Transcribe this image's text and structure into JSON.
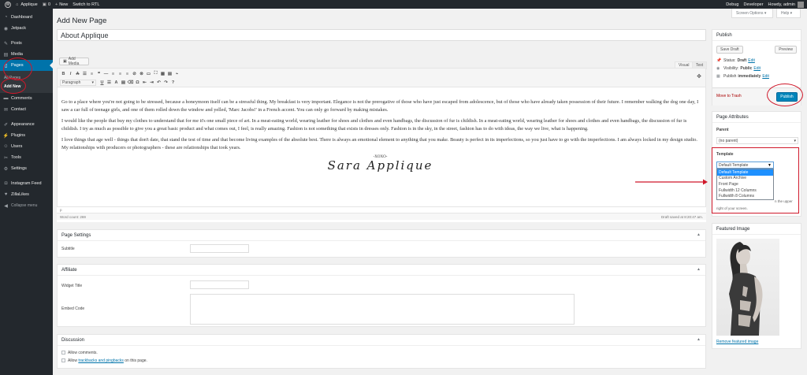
{
  "admin_bar": {
    "site_name": "Applique",
    "comments_count": "0",
    "new_label": "New",
    "rtl_label": "Switch to RTL",
    "debug_label": "Debug",
    "developer_label": "Developer",
    "howdy_label": "Howdy, admin"
  },
  "sidebar": {
    "items": [
      {
        "label": "Dashboard",
        "icon": "dashboard-icon"
      },
      {
        "label": "Jetpack",
        "icon": "jetpack-icon"
      },
      {
        "label": "Posts",
        "icon": "pin-icon"
      },
      {
        "label": "Media",
        "icon": "media-icon"
      },
      {
        "label": "Pages",
        "icon": "pages-icon"
      },
      {
        "label": "Comments",
        "icon": "comment-icon"
      },
      {
        "label": "Contact",
        "icon": "contact-icon"
      },
      {
        "label": "Appearance",
        "icon": "brush-icon"
      },
      {
        "label": "Plugins",
        "icon": "plugin-icon"
      },
      {
        "label": "Users",
        "icon": "users-icon"
      },
      {
        "label": "Tools",
        "icon": "tools-icon"
      },
      {
        "label": "Settings",
        "icon": "settings-icon"
      },
      {
        "label": "Instagram Feed",
        "icon": "instagram-icon"
      },
      {
        "label": "ZillaLikes",
        "icon": "heart-icon"
      }
    ],
    "sub_all_pages": "All Pages",
    "sub_add_new": "Add New",
    "collapse_label": "Collapse menu"
  },
  "header": {
    "title": "Add New Page",
    "screen_options": "Screen Options ▾",
    "help": "Help ▾"
  },
  "post": {
    "title_value": "About Applique"
  },
  "editor": {
    "add_media": "Add Media",
    "tab_visual": "Visual",
    "tab_text": "Text",
    "format_select": "Paragraph",
    "paragraphs": [
      "Go to a place where you're not going to be stressed, because a honeymoon itself can be a stressful thing. My breakfast is very important. Elegance is not the prerogative of those who have just escaped from adolescence, but of those who have already taken possession of their future. I remember walking the dog one day, I saw a car full of teenage girls, and one of them rolled down the window and yelled, 'Marc Jacobs!' in a French accent. You can only go forward by making mistakes.",
      "I would like the people that buy my clothes to understand that for me it's one small piece of art. In a meat-eating world, wearing leather for shoes and clothes and even handbags, the discussion of fur is childish. In a meat-eating world, wearing leather for shoes and clothes and even handbags, the discussion of fur is childish. I try as much as possible to give you a great basic product and what comes out, I feel, is really amazing. Fashion is not something that exists in dresses only. Fashion is in the sky, in the street, fashion has to do with ideas, the way we live, what is happening.",
      "I love things that age well - things that don't date, that stand the test of time and that become living examples of the absolute best. There is always an emotional element to anything that you make. Beauty is perfect in its imperfections, so you just have to go with the imperfections. I am always locked in my design studio. My relationships with producers or photographers - these are relationships that took years."
    ],
    "divider": "-XOXO-",
    "signature": "Sara Applique",
    "path_label": "p",
    "word_count": "Word count: 269",
    "draft_saved": "Draft saved at 8:20:47 am."
  },
  "page_settings": {
    "heading": "Page Settings",
    "subtitle_label": "Subtitle",
    "subtitle_value": ""
  },
  "affiliate": {
    "heading": "Affiliate",
    "widget_title_label": "Widget Title",
    "widget_title_value": "",
    "embed_code_label": "Embed Code",
    "embed_code_value": ""
  },
  "discussion": {
    "heading": "Discussion",
    "allow_comments": "Allow comments.",
    "allow_prefix": "Allow ",
    "trackbacks_link": "trackbacks and pingbacks",
    "allow_suffix": " on this page."
  },
  "publish": {
    "heading": "Publish",
    "save_draft": "Save Draft",
    "preview": "Preview",
    "status_label": "Status:",
    "status_value": "Draft",
    "visibility_label": "Visibility:",
    "visibility_value": "Public",
    "publish_label": "Publish",
    "publish_value": "immediately",
    "edit_link": "Edit",
    "move_to_trash": "Move to Trash",
    "publish_button": "Publish"
  },
  "page_attributes": {
    "heading": "Page Attributes",
    "parent_label": "Parent",
    "parent_value": "(no parent)",
    "template_label": "Template",
    "template_value": "Default Template",
    "template_options": [
      "Default Template",
      "Custom Archive",
      "Front Page",
      "Fullwidth 12 Columns",
      "Fullwidth 8 Columns"
    ],
    "help_tail_1": "n the upper",
    "help_tail_2": "right of your screen."
  },
  "featured_image": {
    "heading": "Featured Image",
    "remove_link": "Remove featured image"
  },
  "colors": {
    "accent": "#0073aa",
    "annotation_red": "#d0182a",
    "sidebar_bg": "#23282d"
  }
}
